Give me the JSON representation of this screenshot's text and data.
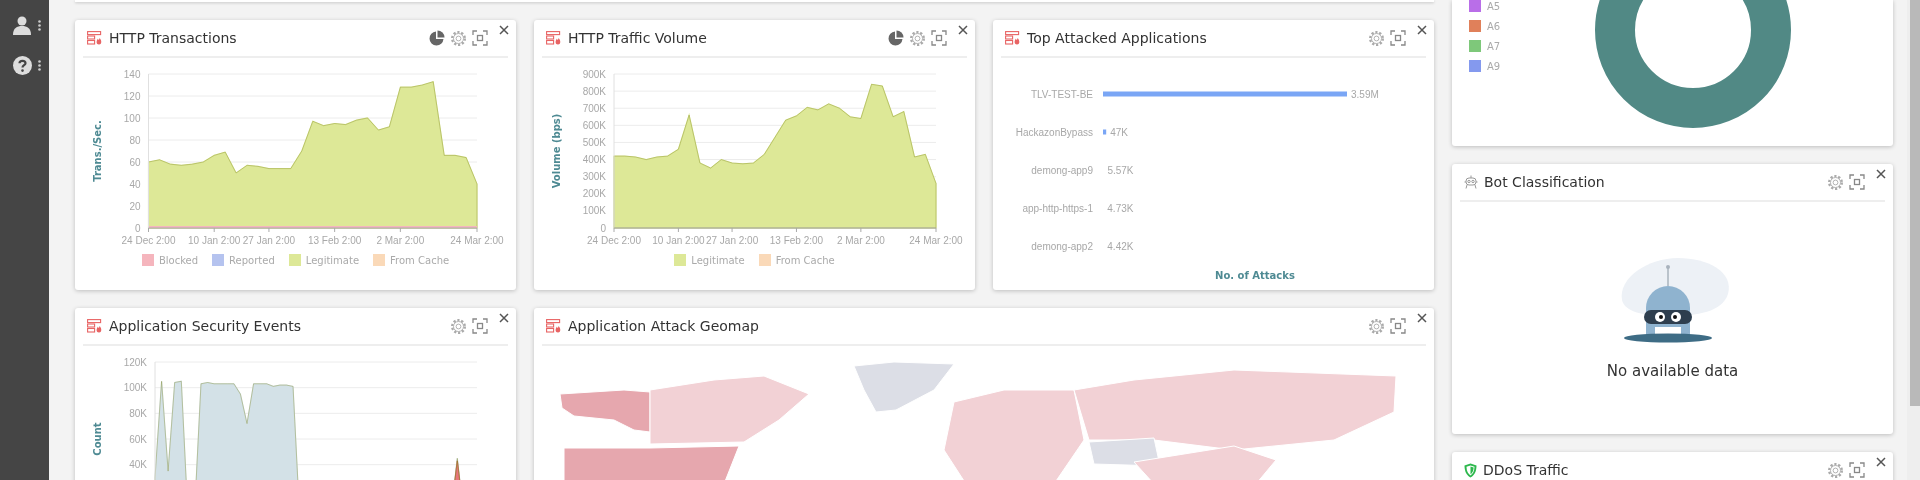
{
  "row_1": [
    {
      "title": "HTTP Transactions",
      "chart_type_toggle": true,
      "body": {
        "kind": "area_chart",
        "chart_data": {
          "type": "area",
          "ylabel": "Trans./Sec.",
          "grid": true,
          "ylim": [
            0,
            140
          ],
          "categories": [
            "24 Dec 2:00",
            null,
            null,
            null,
            null,
            null,
            "10 Jan 2:00",
            null,
            null,
            null,
            null,
            "27 Jan 2:00",
            null,
            null,
            null,
            null,
            null,
            "13 Feb 2:00",
            null,
            null,
            null,
            null,
            null,
            "2 Mar 2:00",
            null,
            null,
            null,
            null,
            null,
            null,
            "24 Mar 2:00"
          ],
          "yticks": [
            0,
            20,
            40,
            60,
            80,
            100,
            120,
            140
          ],
          "series": [
            {
              "name": "Blocked",
              "color": "#f5b5bd",
              "values": [
                0,
                0,
                0,
                0,
                0,
                0,
                0,
                0,
                0,
                0,
                0,
                0,
                0,
                0,
                0,
                0,
                0,
                0,
                0,
                0,
                0,
                0,
                0,
                0,
                0,
                0,
                0,
                0,
                0,
                0,
                0
              ]
            },
            {
              "name": "Reported",
              "color": "#b5c3ef",
              "values": [
                null,
                null,
                null,
                null,
                null,
                null,
                null,
                null,
                null,
                null,
                null,
                null,
                null,
                null,
                null,
                null,
                null,
                null,
                null,
                null,
                null,
                null,
                null,
                null,
                null,
                null,
                null,
                null,
                null,
                null,
                null
              ]
            },
            {
              "name": "Legitimate",
              "color": "#dde897",
              "values": [
                60,
                62,
                58,
                57,
                58,
                60,
                66,
                69,
                50,
                57,
                56,
                54,
                54,
                54,
                70,
                97,
                93,
                95,
                94,
                98,
                100,
                89,
                92,
                128,
                128,
                130,
                133,
                66,
                66,
                64,
                40
              ]
            },
            {
              "name": "From Cache",
              "color": "#fad9b8",
              "values": [
                null,
                null,
                null,
                null,
                null,
                null,
                null,
                null,
                null,
                null,
                null,
                null,
                null,
                null,
                null,
                null,
                null,
                null,
                null,
                null,
                null,
                null,
                null,
                null,
                null,
                null,
                null,
                null,
                null,
                null,
                null
              ]
            }
          ]
        }
      }
    },
    {
      "title": "HTTP Traffic Volume",
      "chart_type_toggle": true,
      "body": {
        "kind": "area_chart",
        "chart_data": {
          "type": "area",
          "ylabel": "Volume (bps)",
          "grid": true,
          "ylim": [
            0,
            900000
          ],
          "categories": [
            "24 Dec 2:00",
            null,
            null,
            null,
            null,
            null,
            "10 Jan 2:00",
            null,
            null,
            null,
            null,
            "27 Jan 2:00",
            null,
            null,
            null,
            null,
            null,
            "13 Feb 2:00",
            null,
            null,
            null,
            null,
            null,
            "2 Mar 2:00",
            null,
            null,
            null,
            null,
            null,
            null,
            "24 Mar 2:00"
          ],
          "yticks": [
            0,
            {
              "value": 100000,
              "label": "100K"
            },
            {
              "value": 200000,
              "label": "200K"
            },
            {
              "value": 300000,
              "label": "300K"
            },
            {
              "value": 400000,
              "label": "400K"
            },
            {
              "value": 500000,
              "label": "500K"
            },
            {
              "value": 600000,
              "label": "600K"
            },
            {
              "value": 700000,
              "label": "700K"
            },
            {
              "value": 800000,
              "label": "800K"
            },
            {
              "value": 900000,
              "label": "900K"
            }
          ],
          "series": [
            {
              "name": "Legitimate",
              "color": "#dde897",
              "values": [
                420000,
                420000,
                415000,
                400000,
                415000,
                420000,
                460000,
                660000,
                380000,
                350000,
                400000,
                380000,
                375000,
                380000,
                430000,
                530000,
                630000,
                655000,
                705000,
                690000,
                725000,
                700000,
                650000,
                640000,
                840000,
                830000,
                650000,
                680000,
                415000,
                430000,
                260000
              ]
            },
            {
              "name": "From Cache",
              "color": "#fad9b8",
              "values": [
                null,
                null,
                null,
                null,
                null,
                null,
                null,
                null,
                null,
                null,
                null,
                null,
                null,
                null,
                null,
                null,
                null,
                null,
                null,
                null,
                null,
                null,
                null,
                null,
                null,
                null,
                null,
                null,
                null,
                null,
                null
              ]
            }
          ]
        }
      }
    },
    {
      "title": "Top Attacked Applications",
      "body": {
        "kind": "bar_chart",
        "chart_data": {
          "type": "bar",
          "orientation": "horizontal",
          "xlabel": "No. of Attacks",
          "categories": [
            "TLV-TEST-BE",
            "HackazonBypass",
            "demong-app9",
            "app-http-https-1",
            "demong-app2"
          ],
          "values": [
            3590000,
            47000,
            5570,
            4730,
            4420
          ],
          "value_labels": [
            "3.59M",
            "47K",
            "5.57K",
            "4.73K",
            "4.42K"
          ]
        }
      }
    }
  ],
  "row_2": [
    {
      "title": "Application Security Events",
      "body": {
        "kind": "area_chart",
        "chart_data": {
          "type": "area",
          "ylabel": "Count",
          "grid": true,
          "ylim": [
            0,
            120000
          ],
          "yticks": [
            {
              "value": 40000,
              "label": "40K"
            },
            {
              "value": 60000,
              "label": "60K"
            },
            {
              "value": 80000,
              "label": "80K"
            },
            {
              "value": 100000,
              "label": "100K"
            },
            {
              "value": 120000,
              "label": "120K"
            }
          ],
          "series": [
            {
              "color": "#d3e1e7",
              "values": [
                30000,
                105000,
                35000,
                104000,
                105000,
                0,
                0,
                103000,
                104000,
                103000,
                103000,
                103000,
                103000,
                95000,
                72000,
                103000,
                103000,
                103000,
                101000,
                102000,
                102000,
                101000,
                0,
                0,
                0,
                0,
                0,
                0,
                0,
                0,
                0,
                0,
                0,
                0,
                0,
                0,
                0,
                0,
                0,
                0,
                0,
                0,
                0,
                0,
                0,
                0,
                45000,
                0,
                0,
                0
              ]
            },
            {
              "color": "#e8767c",
              "values": [
                0,
                0,
                0,
                0,
                0,
                0,
                0,
                0,
                0,
                0,
                0,
                0,
                0,
                0,
                0,
                0,
                0,
                0,
                0,
                0,
                0,
                0,
                0,
                0,
                0,
                0,
                0,
                0,
                0,
                0,
                0,
                0,
                0,
                0,
                0,
                0,
                0,
                0,
                0,
                0,
                0,
                0,
                0,
                0,
                0,
                0,
                43000,
                0,
                0,
                0
              ]
            }
          ]
        }
      }
    },
    {
      "title": "Application Attack Geomap",
      "body": {
        "kind": "map"
      }
    }
  ],
  "right_column": [
    {
      "body": {
        "kind": "donut",
        "legend": [
          {
            "label": "A5",
            "color": "#b96ee8"
          },
          {
            "label": "A6",
            "color": "#e0805a"
          },
          {
            "label": "A7",
            "color": "#7ec87a"
          },
          {
            "label": "A9",
            "color": "#8499ee"
          }
        ]
      }
    },
    {
      "title": "Bot Classification",
      "body": {
        "kind": "empty",
        "message": "No available data"
      }
    },
    {
      "title": "DDoS Traffic"
    }
  ]
}
